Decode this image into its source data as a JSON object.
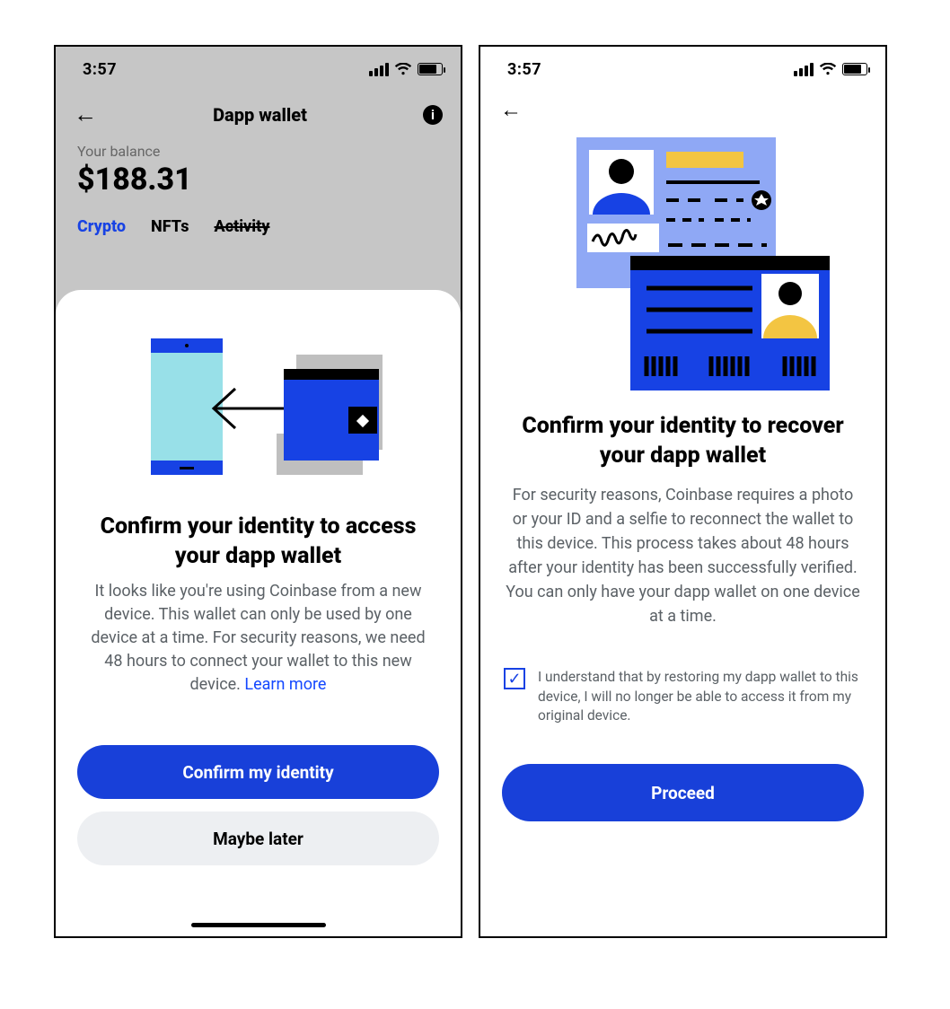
{
  "statusbar": {
    "time": "3:57"
  },
  "left": {
    "nav": {
      "title": "Dapp wallet"
    },
    "balance": {
      "label": "Your balance",
      "value": "$188.31"
    },
    "tabs": {
      "crypto": "Crypto",
      "nfts": "NFTs",
      "activity": "Activity"
    },
    "sheet": {
      "title": "Confirm your identity to access your dapp wallet",
      "body": "It looks like you're using Coinbase from a new device. This wallet can only be used by one device at a time. For security reasons, we need 48 hours to connect your wallet to this new device. ",
      "learn_more": "Learn more",
      "confirm": "Confirm my identity",
      "later": "Maybe later"
    }
  },
  "right": {
    "title": "Confirm your identity to recover your dapp wallet",
    "body": "For security reasons, Coinbase requires a photo or your ID and a selfie to reconnect the wallet to this device. This process takes about 48 hours after your identity has been successfully verified. You can only have your dapp wallet on one device at a time.",
    "disclaimer": "I understand that by restoring my dapp wallet to this device, I will no longer be able to access it from my original device.",
    "proceed": "Proceed"
  }
}
